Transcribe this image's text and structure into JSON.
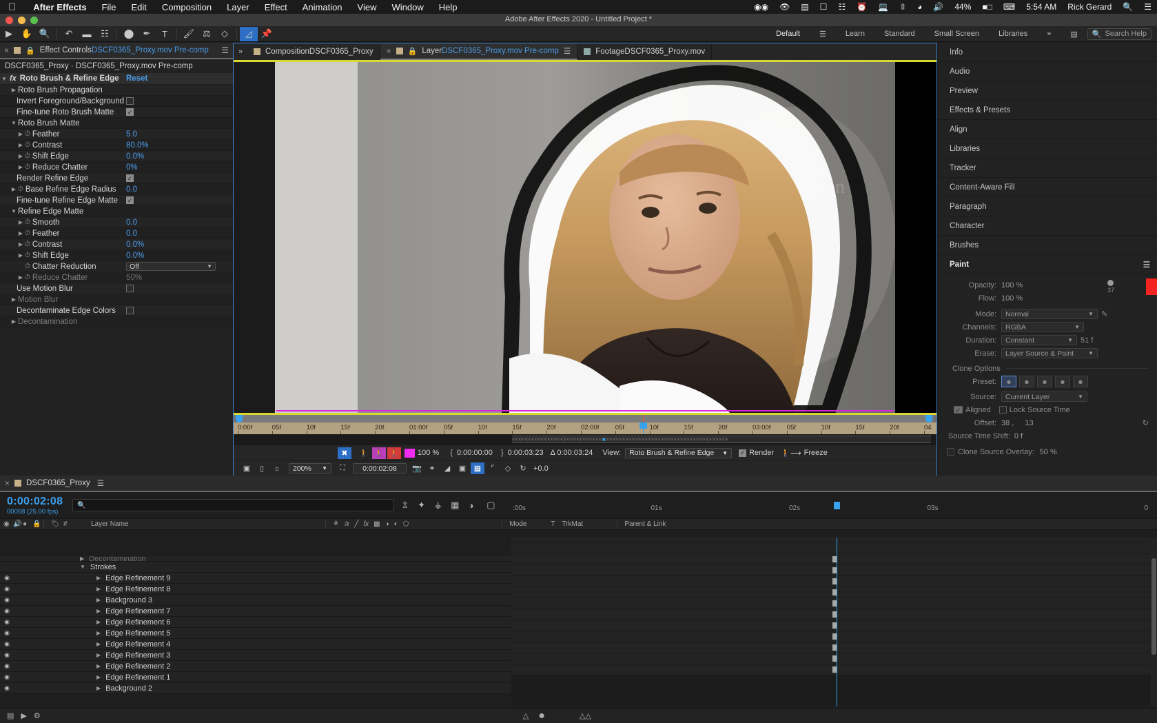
{
  "mac_menu": {
    "apple": "apple-logo",
    "app": "After Effects",
    "items": [
      "File",
      "Edit",
      "Composition",
      "Layer",
      "Effect",
      "Animation",
      "View",
      "Window",
      "Help"
    ],
    "status": {
      "battery_pct": "44%",
      "time": "5:54 AM",
      "user": "Rick Gerard"
    }
  },
  "window": {
    "title": "Adobe After Effects 2020 - Untitled Project *"
  },
  "toolbar": {
    "workspaces": [
      "Default",
      "Learn",
      "Standard",
      "Small Screen",
      "Libraries"
    ],
    "active_workspace": "Default",
    "search_placeholder": "Search Help",
    "overflow": "»"
  },
  "effect_controls": {
    "tab_title_prefix": "Effect Controls ",
    "tab_title_item": "DSCF0365_Proxy.mov Pre-comp",
    "breadcrumb": "DSCF0365_Proxy · DSCF0365_Proxy.mov Pre-comp",
    "effect_name": "Roto Brush & Refine Edge",
    "reset_label": "Reset",
    "rows": [
      {
        "label": "Roto Brush Propagation",
        "type": "group",
        "indent": 1
      },
      {
        "label": "Invert Foreground/Background",
        "type": "checkbox",
        "checked": false,
        "indent": 2
      },
      {
        "label": "Fine-tune Roto Brush Matte",
        "type": "checkbox",
        "checked": true,
        "indent": 2
      },
      {
        "label": "Roto Brush Matte",
        "type": "subgroup",
        "indent": 1
      },
      {
        "label": "Feather",
        "type": "value",
        "value": "5.0",
        "indent": 2
      },
      {
        "label": "Contrast",
        "type": "value",
        "value": "80.0%",
        "indent": 2
      },
      {
        "label": "Shift Edge",
        "type": "value",
        "value": "0.0%",
        "indent": 2
      },
      {
        "label": "Reduce Chatter",
        "type": "value",
        "value": "0%",
        "indent": 2
      },
      {
        "label": "Render Refine Edge",
        "type": "checkbox",
        "checked": true,
        "indent": 2
      },
      {
        "label": "Base Refine Edge Radius",
        "type": "value",
        "value": "0.0",
        "indent": 1
      },
      {
        "label": "Fine-tune Refine Edge Matte",
        "type": "checkbox",
        "checked": true,
        "indent": 2
      },
      {
        "label": "Refine Edge Matte",
        "type": "subgroup",
        "indent": 1
      },
      {
        "label": "Smooth",
        "type": "value",
        "value": "0.0",
        "indent": 2
      },
      {
        "label": "Feather",
        "type": "value",
        "value": "0.0",
        "indent": 2
      },
      {
        "label": "Contrast",
        "type": "value",
        "value": "0.0%",
        "indent": 2
      },
      {
        "label": "Shift Edge",
        "type": "value",
        "value": "0.0%",
        "indent": 2
      },
      {
        "label": "Chatter Reduction",
        "type": "dropdown",
        "value": "Off",
        "indent": 2
      },
      {
        "label": "Reduce Chatter",
        "type": "value",
        "value": "50%",
        "indent": 2,
        "disabled": true
      },
      {
        "label": "Use Motion Blur",
        "type": "checkbox",
        "checked": false,
        "indent": 2
      },
      {
        "label": "Motion Blur",
        "type": "group",
        "indent": 1,
        "disabled": true
      },
      {
        "label": "Decontaminate Edge Colors",
        "type": "checkbox",
        "checked": false,
        "indent": 2
      },
      {
        "label": "Decontamination",
        "type": "group",
        "indent": 1,
        "disabled": true
      }
    ]
  },
  "viewer": {
    "tabs": [
      {
        "label_prefix": "Composition ",
        "label_item": "DSCF0365_Proxy",
        "active": false,
        "locked": false
      },
      {
        "label_prefix": "Layer ",
        "label_item": "DSCF0365_Proxy.mov Pre-comp",
        "active": true,
        "locked": true
      },
      {
        "label_prefix": "Footage ",
        "label_item": "DSCF0365_Proxy.mov",
        "active": false,
        "locked": false
      }
    ],
    "ruler_ticks": [
      "0:00f",
      "05f",
      "10f",
      "15f",
      "20f",
      "01:00f",
      "05f",
      "10f",
      "15f",
      "20f",
      "02:00f",
      "05f",
      "10f",
      "15f",
      "20f",
      "03:00f",
      "05f",
      "10f",
      "15f",
      "20f",
      "04"
    ],
    "toolbar_top": {
      "alpha_label": "100 %",
      "in_point": "0:00:00:00",
      "out_point": "0:00:03:23",
      "duration": "Δ 0:00:03:24",
      "view_label": "View:",
      "view_value": "Roto Brush & Refine Edge",
      "render_label": "Render",
      "render_checked": true,
      "freeze_label": "Freeze"
    },
    "toolbar_bottom": {
      "zoom": "200%",
      "time": "0:00:02:08",
      "exposure": "+0.0"
    }
  },
  "right_panel": {
    "items": [
      "Info",
      "Audio",
      "Preview",
      "Effects & Presets",
      "Align",
      "Libraries",
      "Tracker",
      "Content-Aware Fill",
      "Paragraph",
      "Character",
      "Brushes",
      "Paint"
    ],
    "active_item": "Paint",
    "paint": {
      "opacity_label": "Opacity:",
      "opacity_value": "100 %",
      "flow_label": "Flow:",
      "flow_value": "100 %",
      "mode_label": "Mode:",
      "mode_value": "Normal",
      "channels_label": "Channels:",
      "channels_value": "RGBA",
      "duration_label": "Duration:",
      "duration_value": "Constant",
      "duration_frames": "51 f",
      "erase_label": "Erase:",
      "erase_value": "Layer Source & Paint",
      "clone_options_label": "Clone Options",
      "preset_label": "Preset:",
      "source_label": "Source:",
      "source_value": "Current Layer",
      "aligned_label": "Aligned",
      "aligned_checked": true,
      "lock_source_label": "Lock Source Time",
      "lock_source_checked": false,
      "offset_label": "Offset:",
      "offset_value": "38 ,",
      "offset_value2": "13",
      "source_time_shift_label": "Source Time Shift:",
      "source_time_shift_value": "0 f",
      "clone_overlay_label": "Clone Source Overlay:",
      "clone_overlay_value": "50 %",
      "brush_size": "37"
    },
    "colors": {
      "foreground": "#f2241f",
      "background": "#ffffff"
    }
  },
  "timeline": {
    "tab_label": "DSCF0365_Proxy",
    "current_time": "0:00:02:08",
    "frame_info": "00058 (25.00 fps)",
    "search_placeholder": "",
    "columns": [
      "#",
      "Layer Name",
      "Mode",
      "T",
      "TrkMat",
      "Parent & Link"
    ],
    "time_ticks": [
      ":00s",
      "01s",
      "02s",
      "03s"
    ],
    "end_tick": "0",
    "layers": [
      {
        "name": "Decontamination",
        "indent": 3,
        "partial": true,
        "eye": false
      },
      {
        "name": "Strokes",
        "indent": 3,
        "expanded": true,
        "eye": false
      },
      {
        "name": "Edge Refinement 9",
        "indent": 4,
        "eye": true
      },
      {
        "name": "Edge Refinement 8",
        "indent": 4,
        "eye": true
      },
      {
        "name": "Background 3",
        "indent": 4,
        "eye": true
      },
      {
        "name": "Edge Refinement 7",
        "indent": 4,
        "eye": true
      },
      {
        "name": "Edge Refinement 6",
        "indent": 4,
        "eye": true
      },
      {
        "name": "Edge Refinement 5",
        "indent": 4,
        "eye": true
      },
      {
        "name": "Edge Refinement 4",
        "indent": 4,
        "eye": true
      },
      {
        "name": "Edge Refinement 3",
        "indent": 4,
        "eye": true
      },
      {
        "name": "Edge Refinement 2",
        "indent": 4,
        "eye": true
      },
      {
        "name": "Edge Refinement 1",
        "indent": 4,
        "eye": true
      },
      {
        "name": "Background 2",
        "indent": 4,
        "eye": true
      }
    ]
  }
}
